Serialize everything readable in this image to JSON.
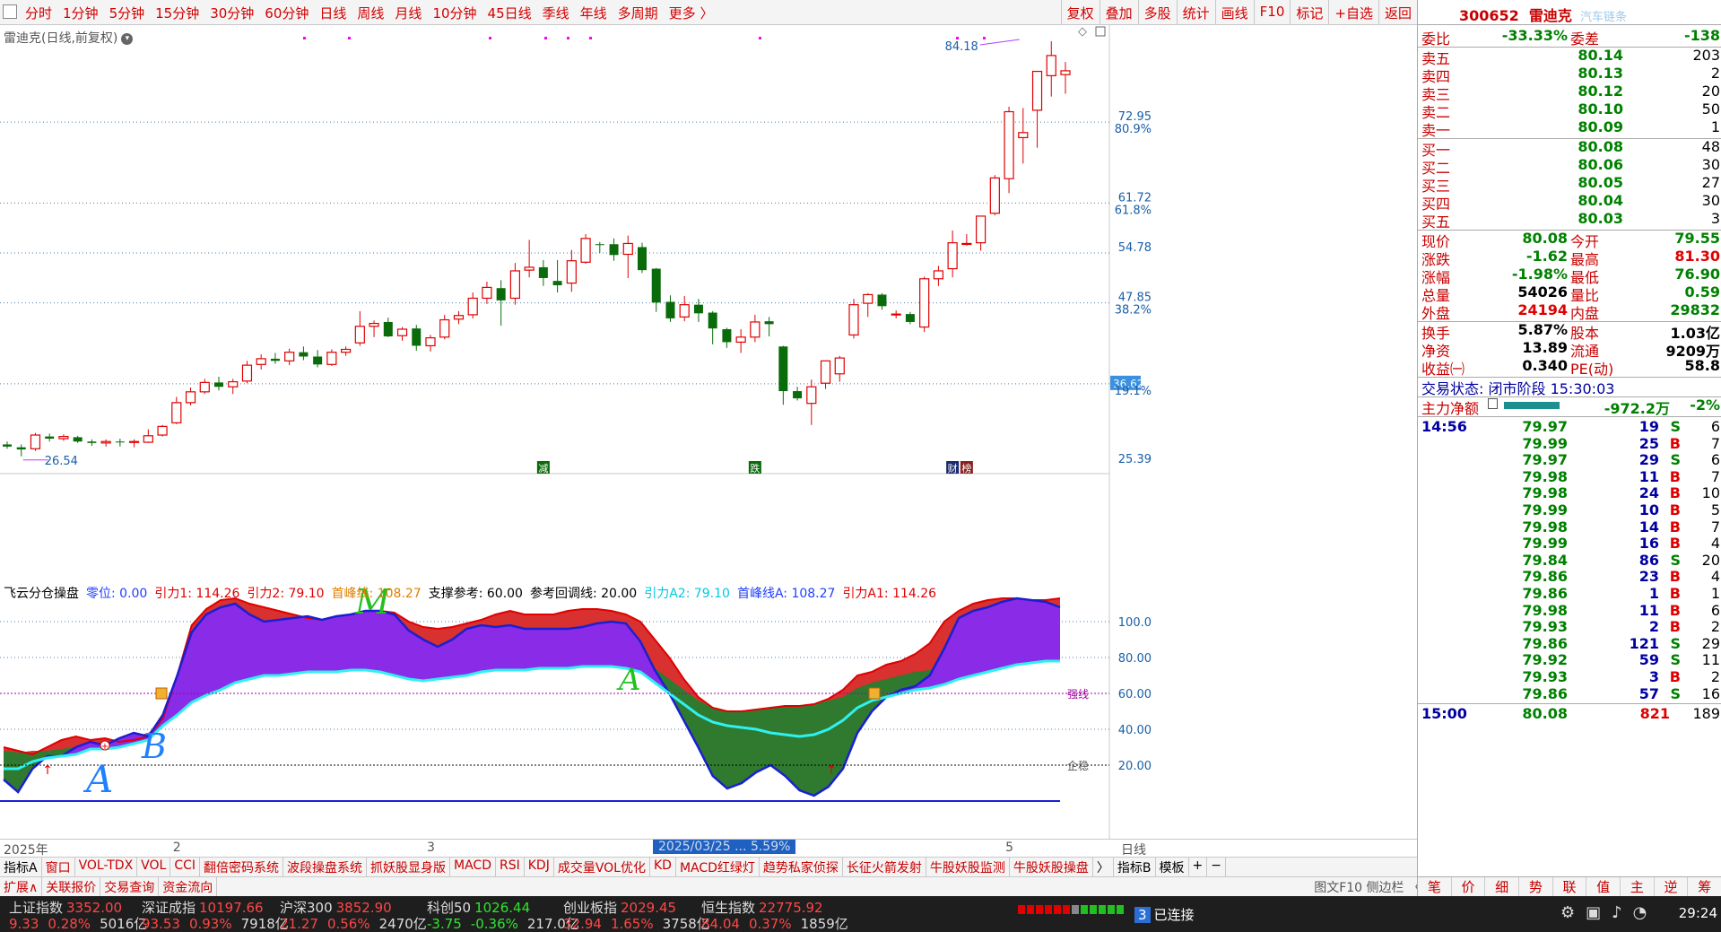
{
  "toolbar": {
    "periods": [
      "分时",
      "1分钟",
      "5分钟",
      "15分钟",
      "30分钟",
      "60分钟",
      "日线",
      "周线",
      "月线",
      "10分钟",
      "45日线",
      "季线",
      "年线",
      "多周期",
      "更多 〉"
    ],
    "right_tools": [
      "复权",
      "叠加",
      "多股",
      "统计",
      "画线",
      "F10",
      "标记",
      "+自选",
      "返回"
    ]
  },
  "chart_title": "雷迪克(日线,前复权)",
  "price_axis": {
    "labels": [
      {
        "value": "72.95",
        "pct": "80.9%",
        "price": 72.95
      },
      {
        "value": "61.72",
        "pct": "61.8%",
        "price": 61.72
      },
      {
        "value": "54.78",
        "pct": "",
        "price": 54.78
      },
      {
        "value": "47.85",
        "pct": "38.2%",
        "price": 47.85
      },
      {
        "value": "36.62",
        "pct": "19.1%",
        "price": 36.62
      },
      {
        "value": "25.39",
        "pct": "",
        "price": 25.39
      }
    ],
    "highlight": "36.62"
  },
  "annotations": {
    "high": "84.18",
    "low": "26.54",
    "high_price": 84.18,
    "low_price": 26.54,
    "low_index": 1,
    "high_index": 72
  },
  "event_markers": [
    {
      "label": "减",
      "index": 38
    },
    {
      "label": "跌",
      "index": 53
    },
    {
      "label": "财",
      "index": 67
    },
    {
      "label": "榜",
      "index": 68
    }
  ],
  "indicator": {
    "name": "飞云分仓操盘",
    "params": [
      {
        "text": "零位: 0.00",
        "color": "#2040ff"
      },
      {
        "text": "引力1: 114.26",
        "color": "#e00000"
      },
      {
        "text": "引力2: 79.10",
        "color": "#e00000"
      },
      {
        "text": "首峰线: 108.27",
        "color": "#e08000"
      },
      {
        "text": "支撑参考: 60.00",
        "color": "#000000"
      },
      {
        "text": "参考回调线: 20.00",
        "color": "#000000"
      },
      {
        "text": "引力A2: 79.10",
        "color": "#00c8e0"
      },
      {
        "text": "首峰线A: 108.27",
        "color": "#2040ff"
      },
      {
        "text": "引力A1: 114.26",
        "color": "#e00000"
      }
    ],
    "axis": [
      "100.0",
      "80.00",
      "60.00",
      "40.00",
      "20.00"
    ],
    "strong_label": "强线",
    "safe_label": "企稳"
  },
  "handwriting": {
    "m": "M",
    "a_mid": "A",
    "a_left": "A",
    "b": "B"
  },
  "date_axis": {
    "labels": [
      {
        "text": "2025年",
        "index": 0
      },
      {
        "text": "2",
        "index": 12
      },
      {
        "text": "3",
        "index": 30
      },
      {
        "text": "5",
        "index": 71
      }
    ],
    "cursor": "2025/03/25 ... 5.59%",
    "period": "日线"
  },
  "tabs1": [
    "指标A",
    "窗口",
    "VOL-TDX",
    "VOL",
    "CCI",
    "翻倍密码系统",
    "波段操盘系统",
    "抓妖股显身版",
    "MACD",
    "RSI",
    "KDJ",
    "成交量VOL优化",
    "KD",
    "MACD红绿灯",
    "趋势私家侦探",
    "长征火箭发射",
    "牛股妖股监测",
    "牛股妖股操盘",
    "〉",
    "指标B",
    "模板",
    "+",
    "−"
  ],
  "tabs2": [
    "扩展∧",
    "关联报价",
    "交易查询",
    "资金流向"
  ],
  "tabs2_right": "图文F10 侧边栏 〈",
  "quote": {
    "code": "300652",
    "name": "雷迪克",
    "sector": "汽车链条",
    "weibi": {
      "k": "委比",
      "v": "-33.33%",
      "k2": "委差",
      "v2": "-138"
    },
    "sells": [
      {
        "k": "卖五",
        "p": "80.14",
        "q": "203"
      },
      {
        "k": "卖四",
        "p": "80.13",
        "q": "2"
      },
      {
        "k": "卖三",
        "p": "80.12",
        "q": "20"
      },
      {
        "k": "卖二",
        "p": "80.10",
        "q": "50"
      },
      {
        "k": "卖一",
        "p": "80.09",
        "q": "1"
      }
    ],
    "buys": [
      {
        "k": "买一",
        "p": "80.08",
        "q": "48"
      },
      {
        "k": "买二",
        "p": "80.06",
        "q": "30"
      },
      {
        "k": "买三",
        "p": "80.05",
        "q": "27"
      },
      {
        "k": "买四",
        "p": "80.04",
        "q": "30"
      },
      {
        "k": "买五",
        "p": "80.03",
        "q": "3"
      }
    ],
    "stats1": [
      {
        "k": "现价",
        "v": "80.08",
        "k2": "今开",
        "v2": "79.55",
        "c": "green",
        "c2": "green"
      },
      {
        "k": "涨跌",
        "v": "-1.62",
        "k2": "最高",
        "v2": "81.30",
        "c": "green",
        "c2": "red"
      },
      {
        "k": "涨幅",
        "v": "-1.98%",
        "k2": "最低",
        "v2": "76.90",
        "c": "green",
        "c2": "green"
      },
      {
        "k": "总量",
        "v": "54026",
        "k2": "量比",
        "v2": "0.59",
        "c": "blk",
        "c2": "green"
      },
      {
        "k": "外盘",
        "v": "24194",
        "k2": "内盘",
        "v2": "29832",
        "c": "red",
        "c2": "green"
      }
    ],
    "stats2": [
      {
        "k": "换手",
        "v": "5.87%",
        "k2": "股本",
        "v2": "1.03亿",
        "c": "blk",
        "c2": "blk"
      },
      {
        "k": "净资",
        "v": "13.89",
        "k2": "流通",
        "v2": "9209万",
        "c": "blk",
        "c2": "blk"
      },
      {
        "k": "收益㈠",
        "v": "0.340",
        "k2": "PE(动)",
        "v2": "58.8",
        "c": "blk",
        "c2": "blk"
      }
    ],
    "trade_state": "交易状态: 闭市阶段 15:30:03",
    "main_flow": {
      "k": "主力净额",
      "v": "-972.2万",
      "p": "-2%"
    },
    "ticks": [
      {
        "t": "14:56",
        "p": "79.97",
        "q": "19",
        "bs": "S",
        "n": "6"
      },
      {
        "t": "",
        "p": "79.99",
        "q": "25",
        "bs": "B",
        "n": "7"
      },
      {
        "t": "",
        "p": "79.97",
        "q": "29",
        "bs": "S",
        "n": "6"
      },
      {
        "t": "",
        "p": "79.98",
        "q": "11",
        "bs": "B",
        "n": "7"
      },
      {
        "t": "",
        "p": "79.98",
        "q": "24",
        "bs": "B",
        "n": "10"
      },
      {
        "t": "",
        "p": "79.99",
        "q": "10",
        "bs": "B",
        "n": "5"
      },
      {
        "t": "",
        "p": "79.98",
        "q": "14",
        "bs": "B",
        "n": "7"
      },
      {
        "t": "",
        "p": "79.99",
        "q": "16",
        "bs": "B",
        "n": "4"
      },
      {
        "t": "",
        "p": "79.84",
        "q": "86",
        "bs": "S",
        "n": "20"
      },
      {
        "t": "",
        "p": "79.86",
        "q": "23",
        "bs": "B",
        "n": "4"
      },
      {
        "t": "",
        "p": "79.86",
        "q": "1",
        "bs": "B",
        "n": "1"
      },
      {
        "t": "",
        "p": "79.98",
        "q": "11",
        "bs": "B",
        "n": "6"
      },
      {
        "t": "",
        "p": "79.93",
        "q": "2",
        "bs": "B",
        "n": "2"
      },
      {
        "t": "",
        "p": "79.86",
        "q": "121",
        "bs": "S",
        "n": "29"
      },
      {
        "t": "",
        "p": "79.92",
        "q": "59",
        "bs": "S",
        "n": "11"
      },
      {
        "t": "",
        "p": "79.93",
        "q": "3",
        "bs": "B",
        "n": "2"
      },
      {
        "t": "",
        "p": "79.86",
        "q": "57",
        "bs": "S",
        "n": "16"
      }
    ],
    "close_tick": {
      "t": "15:00",
      "p": "80.08",
      "q": "821",
      "n": "189"
    },
    "foot": [
      "笔",
      "价",
      "细",
      "势",
      "联",
      "值",
      "主",
      "逆",
      "筹"
    ]
  },
  "status": {
    "indices": [
      {
        "name": "上证指数",
        "value": "3352.00",
        "chg": "9.33",
        "pct": "0.28%",
        "amt": "5016亿",
        "up": true
      },
      {
        "name": "深证成指",
        "value": "10197.66",
        "chg": "93.53",
        "pct": "0.93%",
        "amt": "7918亿",
        "up": true
      },
      {
        "name": "沪深300",
        "value": "3852.90",
        "chg": "21.27",
        "pct": "0.56%",
        "amt": "2470亿",
        "up": true
      },
      {
        "name": "科创50",
        "value": "1026.44",
        "chg": "-3.75",
        "pct": "-0.36%",
        "amt": "217.0亿",
        "up": false
      },
      {
        "name": "创业板指",
        "value": "2029.45",
        "chg": "32.94",
        "pct": "1.65%",
        "amt": "3758亿",
        "up": true
      },
      {
        "name": "恒生指数",
        "value": "22775.92",
        "chg": "84.04",
        "pct": "0.37%",
        "amt": "1859亿",
        "up": true
      }
    ],
    "connection_badge": "3",
    "connection": "已连接",
    "clock": "29:24"
  },
  "chart_data": {
    "type": "candlestick",
    "title": "雷迪克(日线,前复权)",
    "ylim": [
      25.39,
      84.18
    ],
    "candles": [
      [
        28.2,
        28.6,
        27.6,
        27.9
      ],
      [
        27.8,
        28.2,
        26.54,
        27.5
      ],
      [
        27.6,
        29.8,
        27.3,
        29.5
      ],
      [
        29.3,
        29.7,
        28.6,
        29.0
      ],
      [
        29.0,
        29.6,
        28.7,
        29.3
      ],
      [
        29.2,
        29.4,
        28.4,
        28.6
      ],
      [
        28.6,
        28.9,
        28.0,
        28.4
      ],
      [
        28.4,
        28.9,
        27.9,
        28.6
      ],
      [
        28.6,
        29.0,
        27.9,
        28.5
      ],
      [
        28.5,
        28.9,
        27.8,
        28.6
      ],
      [
        28.5,
        30.3,
        28.4,
        29.4
      ],
      [
        29.5,
        30.9,
        29.3,
        30.7
      ],
      [
        31.2,
        34.8,
        31.0,
        34.0
      ],
      [
        34.0,
        36.1,
        33.6,
        35.5
      ],
      [
        35.5,
        37.3,
        35.2,
        36.8
      ],
      [
        36.8,
        37.6,
        35.7,
        36.2
      ],
      [
        36.2,
        37.3,
        35.2,
        36.9
      ],
      [
        37.0,
        39.8,
        36.7,
        39.2
      ],
      [
        39.3,
        40.7,
        38.6,
        40.1
      ],
      [
        40.1,
        40.9,
        39.4,
        39.8
      ],
      [
        39.8,
        41.5,
        39.2,
        41.0
      ],
      [
        41.0,
        41.8,
        39.9,
        40.4
      ],
      [
        40.4,
        41.3,
        38.9,
        39.3
      ],
      [
        39.3,
        41.4,
        39.1,
        41.0
      ],
      [
        41.0,
        41.8,
        40.5,
        41.4
      ],
      [
        42.3,
        46.7,
        41.9,
        44.6
      ],
      [
        44.6,
        45.4,
        43.1,
        45.0
      ],
      [
        45.2,
        45.8,
        43.1,
        43.2
      ],
      [
        43.3,
        44.5,
        42.6,
        44.2
      ],
      [
        44.3,
        44.8,
        41.2,
        41.9
      ],
      [
        41.9,
        43.4,
        41.1,
        43.0
      ],
      [
        43.1,
        46.2,
        42.8,
        45.5
      ],
      [
        45.6,
        46.7,
        44.9,
        46.1
      ],
      [
        46.2,
        49.3,
        45.7,
        48.5
      ],
      [
        48.5,
        50.8,
        47.7,
        50.0
      ],
      [
        49.9,
        51.0,
        44.7,
        48.2
      ],
      [
        48.5,
        53.4,
        47.6,
        52.3
      ],
      [
        52.4,
        56.6,
        51.4,
        52.8
      ],
      [
        52.8,
        53.8,
        50.2,
        51.3
      ],
      [
        50.9,
        53.8,
        49.3,
        50.3
      ],
      [
        50.6,
        55.2,
        49.4,
        53.7
      ],
      [
        53.5,
        57.4,
        53.3,
        56.8
      ],
      [
        56.0,
        56.3,
        54.8,
        55.9
      ],
      [
        56.0,
        56.8,
        53.7,
        54.5
      ],
      [
        54.6,
        57.2,
        51.3,
        56.1
      ],
      [
        55.6,
        56.2,
        52.0,
        52.4
      ],
      [
        52.6,
        52.7,
        46.6,
        47.9
      ],
      [
        48.0,
        48.9,
        45.2,
        45.7
      ],
      [
        45.9,
        48.8,
        45.3,
        47.6
      ],
      [
        47.6,
        48.4,
        45.2,
        46.4
      ],
      [
        46.5,
        46.7,
        42.1,
        44.3
      ],
      [
        44.2,
        44.4,
        41.6,
        42.4
      ],
      [
        42.4,
        44.2,
        40.9,
        43.1
      ],
      [
        43.1,
        46.2,
        42.4,
        45.2
      ],
      [
        45.3,
        45.9,
        43.2,
        44.9
      ],
      [
        41.8,
        41.9,
        33.7,
        35.6
      ],
      [
        35.6,
        36.2,
        34.3,
        34.6
      ],
      [
        33.9,
        37.2,
        30.9,
        36.2
      ],
      [
        36.7,
        39.7,
        35.9,
        39.8
      ],
      [
        38.0,
        40.5,
        36.9,
        40.2
      ],
      [
        43.4,
        48.4,
        42.9,
        47.6
      ],
      [
        47.8,
        49.2,
        45.9,
        49.0
      ],
      [
        49.0,
        49.2,
        46.9,
        47.4
      ],
      [
        46.2,
        46.8,
        45.7,
        46.3
      ],
      [
        46.3,
        46.6,
        44.9,
        45.2
      ],
      [
        44.5,
        51.5,
        43.8,
        51.2
      ],
      [
        51.2,
        53.0,
        50.2,
        52.3
      ],
      [
        52.6,
        57.9,
        51.4,
        56.2
      ],
      [
        56.1,
        57.4,
        55.8,
        56.1
      ],
      [
        56.2,
        57.9,
        55.1,
        59.9
      ],
      [
        60.3,
        65.6,
        60.0,
        65.2
      ],
      [
        65.1,
        75.1,
        63.1,
        74.4
      ],
      [
        70.8,
        74.9,
        67.2,
        71.5
      ],
      [
        74.6,
        80.0,
        69.4,
        80.0
      ],
      [
        79.4,
        84.18,
        76.5,
        82.2
      ],
      [
        79.55,
        81.3,
        76.9,
        80.08
      ]
    ],
    "indicator": {
      "upper_red": [
        30,
        28,
        26,
        30,
        34,
        36,
        34,
        35,
        33,
        34,
        36,
        46,
        70,
        98,
        107,
        112,
        113,
        110,
        108,
        106,
        104,
        102,
        101,
        103,
        104,
        106,
        106,
        105,
        100,
        97,
        96,
        97,
        99,
        101,
        104,
        106,
        104,
        104,
        104,
        106,
        107,
        107,
        106,
        104,
        100,
        90,
        80,
        68,
        58,
        52,
        50,
        50,
        51,
        52,
        53,
        53,
        54,
        57,
        62,
        70,
        72,
        76,
        78,
        82,
        88,
        100,
        106,
        110,
        112,
        113,
        113,
        112,
        112,
        113
      ],
      "upper_blue": [
        12,
        5,
        18,
        25,
        25,
        30,
        33,
        31,
        35,
        38,
        36,
        48,
        70,
        94,
        104,
        108,
        110,
        104,
        100,
        101,
        102,
        103,
        101,
        103,
        104,
        106,
        106,
        104,
        95,
        90,
        86,
        90,
        96,
        98,
        97,
        98,
        96,
        96,
        96,
        96,
        97,
        99,
        100,
        99,
        89,
        73,
        60,
        45,
        30,
        14,
        7,
        10,
        16,
        20,
        14,
        6,
        3,
        8,
        18,
        38,
        50,
        58,
        62,
        64,
        70,
        85,
        102,
        106,
        108,
        111,
        113,
        112,
        111,
        108
      ],
      "violet": [
        28,
        27,
        28,
        28,
        29,
        30,
        32,
        33,
        34,
        36,
        38,
        44,
        52,
        60,
        64,
        68,
        72,
        74,
        76,
        78,
        80,
        82,
        83,
        85,
        86,
        87,
        86,
        84,
        80,
        78,
        77,
        78,
        79,
        80,
        80,
        80,
        80,
        79,
        79,
        79,
        80,
        80,
        80,
        80,
        78,
        74,
        68,
        62,
        56,
        52,
        50,
        50,
        51,
        52,
        53,
        53,
        54,
        56,
        58,
        63,
        66,
        68,
        70,
        72,
        73,
        75,
        78,
        80,
        82,
        84,
        86,
        87,
        88,
        88
      ],
      "cyan": [
        18,
        18,
        22,
        24,
        25,
        26,
        29,
        29,
        30,
        32,
        34,
        42,
        48,
        55,
        59,
        62,
        66,
        68,
        70,
        70,
        71,
        72,
        72,
        72,
        73,
        73,
        72,
        70,
        68,
        67,
        68,
        69,
        70,
        72,
        73,
        73,
        73,
        74,
        74,
        74,
        75,
        75,
        75,
        74,
        72,
        66,
        60,
        54,
        48,
        44,
        42,
        41,
        40,
        38,
        37,
        36,
        37,
        40,
        45,
        52,
        56,
        58,
        60,
        62,
        63,
        65,
        68,
        70,
        72,
        74,
        76,
        77,
        78,
        78
      ],
      "ylim": [
        -18,
        118
      ]
    }
  }
}
